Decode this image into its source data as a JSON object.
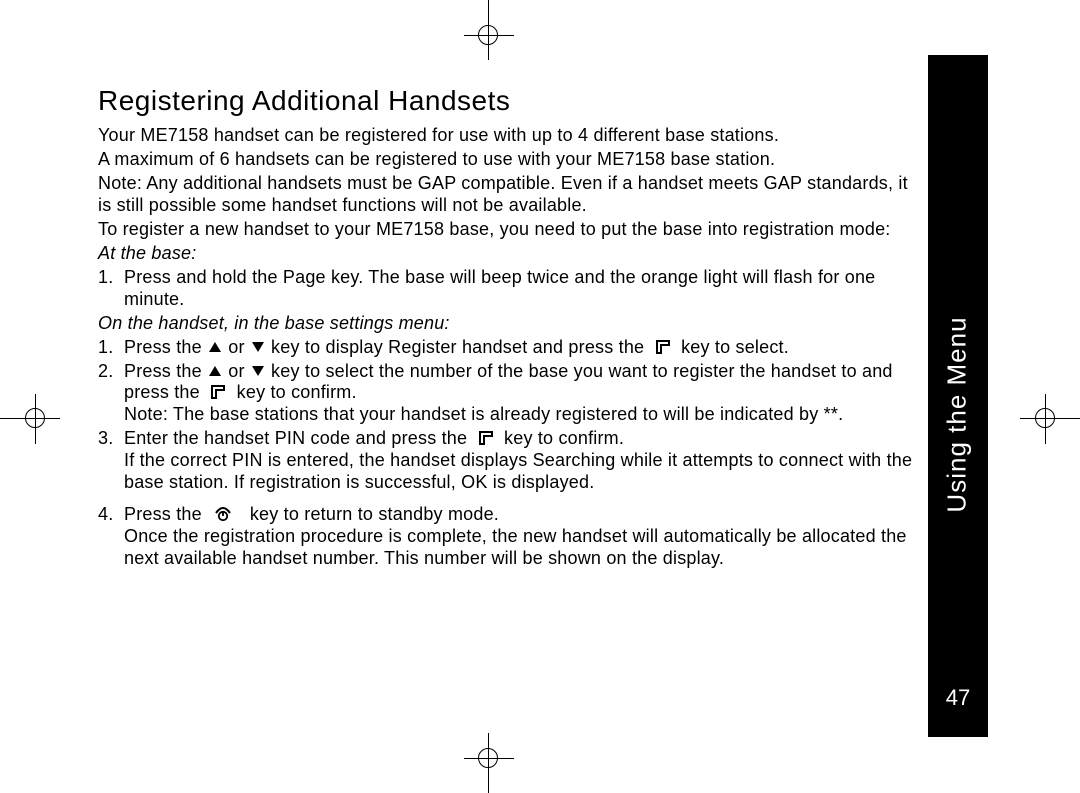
{
  "sideTab": {
    "label": "Using the Menu",
    "pageNumber": "47"
  },
  "heading": "Registering Additional Handsets",
  "intro": {
    "p1": "Your ME7158 handset can be registered for use with up to 4 different base stations.",
    "p2": "A maximum of 6 handsets can be registered to use with your ME7158 base station.",
    "p3": "Note: Any additional handsets must be GAP compatible. Even if a handset meets GAP standards, it is still possible some handset functions will not be available.",
    "p4": "To register a new handset to your ME7158 base, you need to put the base into registration mode:"
  },
  "atBase": {
    "label": "At the base:",
    "step1_num": "1.",
    "step1": "Press and hold the Page key. The base will beep twice and the orange light will flash for one minute."
  },
  "onHandset": {
    "label": "On the handset, in the base settings menu:",
    "step1_num": "1.",
    "step1_a": "Press the ",
    "step1_b": " or ",
    "step1_c": " key to display Register handset and press the ",
    "step1_d": " key to select.",
    "step2_num": "2.",
    "step2_a": "Press the ",
    "step2_b": " or ",
    "step2_c": " key to select the number of the base you want to register the handset to and press the ",
    "step2_d": " key to confirm.",
    "step2_note": "Note: The base stations that your handset is already registered to will be indicated by **.",
    "step3_num": "3.",
    "step3_a": "Enter the handset PIN code and press the ",
    "step3_b": " key to confirm.",
    "step3_note": "If the correct PIN is entered, the handset displays Searching while it attempts to connect with the base station. If registration is successful, OK is displayed.",
    "step4_num": "4.",
    "step4_a": "Press the ",
    "step4_b": " key to return to standby mode.",
    "step4_note": "Once the registration procedure is complete, the new handset will automatically be allocated the next available handset number. This number will be shown on the display."
  }
}
